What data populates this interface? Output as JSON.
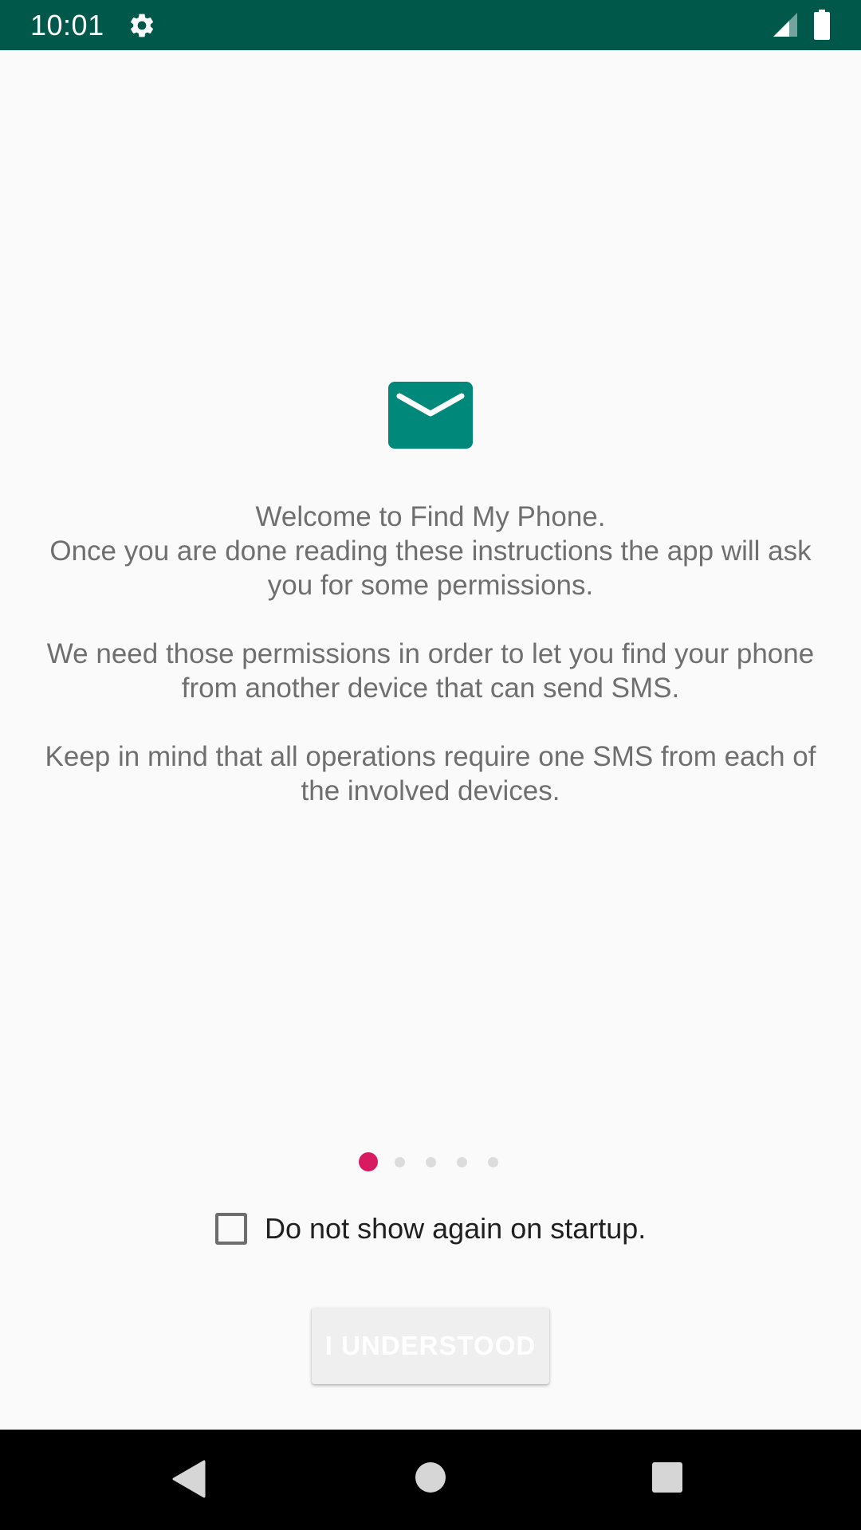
{
  "status_bar": {
    "time": "10:01",
    "icons": [
      "gear-icon",
      "cell-signal-icon",
      "battery-icon"
    ],
    "background_color": "#00584b"
  },
  "hero": {
    "icon": "mail-icon",
    "icon_color": "#00897b"
  },
  "message": {
    "paragraphs": [
      "Welcome to Find My Phone.\nOnce you are done reading these instructions the app will ask you for some permissions.",
      "We need those permissions in order to let you find your phone from another device that can send SMS.",
      "Keep in mind that all operations require one SMS from each of the involved devices."
    ],
    "line1": "Welcome to Find My Phone.",
    "line2": "Once you are done reading these instructions the app will ask you for some permissions.",
    "p2": "We need those permissions in order to let you find your phone from another device that can send SMS.",
    "p3": "Keep in mind that all operations require one SMS from each of the involved devices."
  },
  "pager": {
    "page_count": 5,
    "current_page": 1,
    "active_color": "#d81b60"
  },
  "startup_option": {
    "label": "Do not show again on startup.",
    "checked": false
  },
  "actions": {
    "understood_label": "I UNDERSTOOD",
    "understood_enabled": false
  },
  "nav_bar": {
    "icons": [
      "back-icon",
      "home-icon",
      "recents-icon"
    ]
  }
}
